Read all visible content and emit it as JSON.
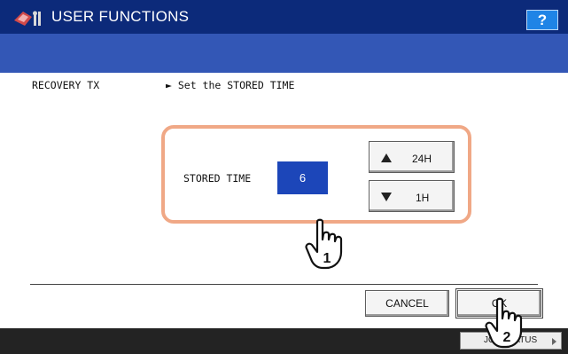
{
  "header": {
    "title": "USER FUNCTIONS",
    "help_label": "?"
  },
  "breadcrumb": {
    "section": "RECOVERY TX",
    "instruction": "► Set the STORED TIME"
  },
  "setting": {
    "label": "STORED TIME",
    "value": "6"
  },
  "buttons": {
    "up_label": "24H",
    "down_label": "1H",
    "cancel_label": "CANCEL",
    "ok_label": "OK"
  },
  "footer": {
    "job_status_label": "JOB STATUS"
  },
  "callouts": {
    "step1": "1",
    "step2": "2"
  },
  "colors": {
    "title_bar": "#0c2a7a",
    "sub_bar": "#3357b6",
    "value_box": "#1c46b9",
    "highlight": "#f0a886",
    "help_button": "#1f84e6"
  },
  "icons": [
    "user-functions-icon",
    "up-arrow-icon",
    "down-arrow-icon",
    "pointing-hand-icon",
    "right-arrow-icon"
  ]
}
